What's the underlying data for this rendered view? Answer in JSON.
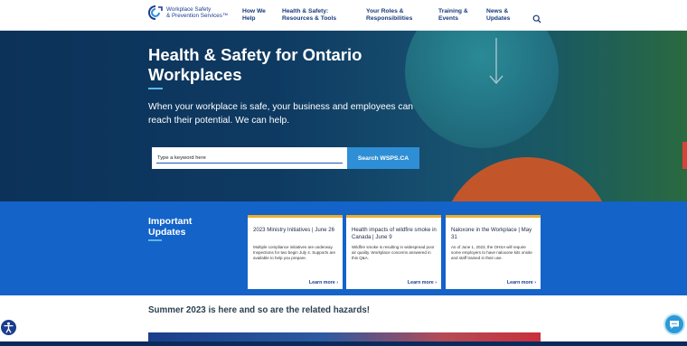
{
  "logo": {
    "line1": "Workplace Safety",
    "line2": "& Prevention Services™"
  },
  "nav": {
    "items": [
      {
        "line1": "How We",
        "line2": "Help"
      },
      {
        "line1": "Health & Safety:",
        "line2": "Resources & Tools"
      },
      {
        "line1": "Your Roles &",
        "line2": "Responsibilities"
      },
      {
        "line1": "Training &",
        "line2": "Events"
      },
      {
        "line1": "News &",
        "line2": "Updates"
      }
    ]
  },
  "hero": {
    "title": "Health & Safety for Ontario Workplaces",
    "subtitle": "When your workplace is safe, your business and employees can reach their potential. We can help.",
    "search_placeholder": "Type a keyword here",
    "search_button": "Search WSPS.CA"
  },
  "updates": {
    "heading": "Important Updates",
    "cards": [
      {
        "title": "2023 Ministry Initiatives | June 26",
        "body": "Multiple compliance initiatives are underway. Inspections for two begin July 4. Supports are available to help you prepare.",
        "link": "Learn more ›"
      },
      {
        "title": "Health impacts of wildfire smoke in Canada | June 9",
        "body": "Wildfire smoke is resulting in widespread poor air quality. Workplace concerns answered in this Q&A.",
        "link": "Learn more ›"
      },
      {
        "title": "Naloxone in the Workplace | May 31",
        "body": "As of June 1, 2023, the OHSA will require some employers to have naloxone kits onsite and staff trained in their use.",
        "link": "Learn more ›"
      }
    ]
  },
  "section": {
    "heading": "Summer 2023 is here and so are the related hazards!"
  },
  "colors": {
    "brand_navy": "#1b3d8f",
    "updates_blue": "#1363c9",
    "card_accent": "#e8b02c",
    "search_button": "#2f8fd6"
  },
  "icons": {
    "search": "search-icon",
    "accessibility": "accessibility-icon",
    "chat": "chat-icon",
    "arrow": "arrow-down-icon"
  }
}
